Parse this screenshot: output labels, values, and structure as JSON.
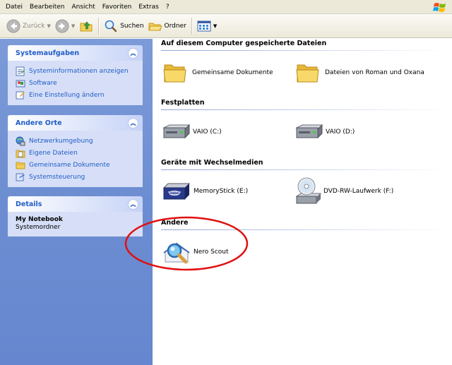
{
  "menu": [
    "Datei",
    "Bearbeiten",
    "Ansicht",
    "Favoriten",
    "Extras",
    "?"
  ],
  "toolbar": {
    "back_label": "Zurück",
    "search_label": "Suchen",
    "folders_label": "Ordner"
  },
  "taskpane": {
    "system_tasks": {
      "title": "Systemaufgaben",
      "items": [
        {
          "label": "Systeminformationen anzeigen",
          "icon": "system-info-icon"
        },
        {
          "label": "Software",
          "icon": "software-icon"
        },
        {
          "label": "Eine Einstellung ändern",
          "icon": "settings-icon"
        }
      ]
    },
    "other_places": {
      "title": "Andere Orte",
      "items": [
        {
          "label": "Netzwerkumgebung",
          "icon": "network-icon"
        },
        {
          "label": "Eigene Dateien",
          "icon": "my-documents-icon"
        },
        {
          "label": "Gemeinsame Dokumente",
          "icon": "folder-icon"
        },
        {
          "label": "Systemsteuerung",
          "icon": "control-panel-icon"
        }
      ]
    },
    "details": {
      "title": "Details",
      "name": "My Notebook",
      "type": "Systemordner"
    }
  },
  "content": {
    "groups": [
      {
        "title": "Auf diesem Computer gespeicherte Dateien",
        "items": [
          {
            "label": "Gemeinsame Dokumente",
            "icon": "folder-icon"
          },
          {
            "label": "Dateien von Roman und Oxana",
            "icon": "folder-icon"
          }
        ]
      },
      {
        "title": "Festplatten",
        "items": [
          {
            "label": "VAIO (C:)",
            "icon": "hard-drive-icon"
          },
          {
            "label": "VAIO (D:)",
            "icon": "hard-drive-icon"
          }
        ]
      },
      {
        "title": "Geräte mit Wechselmedien",
        "items": [
          {
            "label": "MemoryStick (E:)",
            "icon": "memorystick-icon"
          },
          {
            "label": "DVD-RW-Laufwerk (F:)",
            "icon": "dvd-drive-icon"
          }
        ]
      },
      {
        "title": "Andere",
        "items": [
          {
            "label": "Nero Scout",
            "icon": "nero-scout-icon"
          }
        ]
      }
    ]
  },
  "colors": {
    "taskpane_bg": "#7b9bd8",
    "panel_title": "#215dc6",
    "panel_body": "#d6dff7",
    "annotation": "#e01010"
  }
}
